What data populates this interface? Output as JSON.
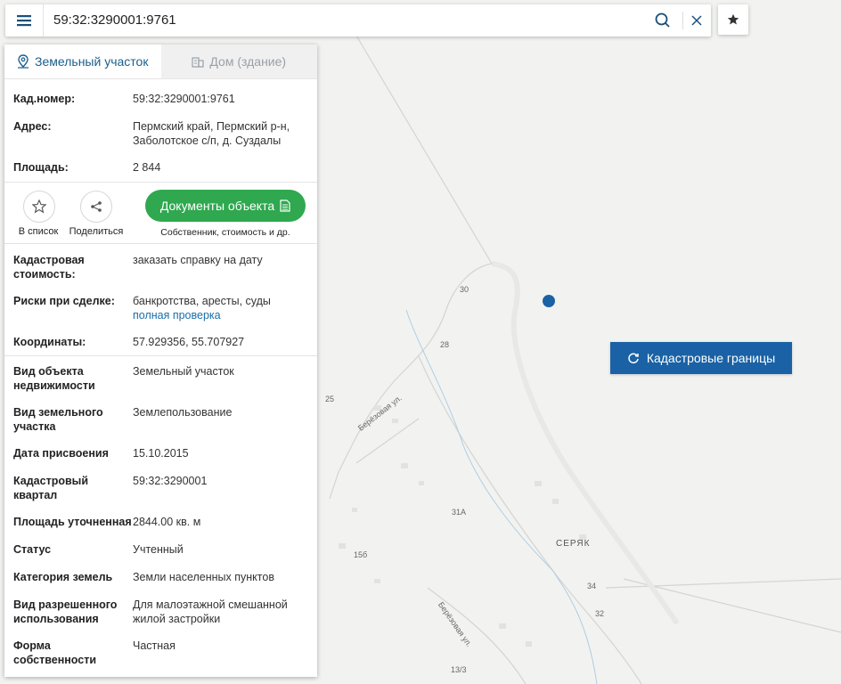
{
  "search": {
    "query": "59:32:3290001:9761"
  },
  "tabs": [
    {
      "label": "Земельный участок",
      "active": true
    },
    {
      "label": "Дом (здание)",
      "active": false
    }
  ],
  "summary": {
    "cad_number_label": "Кад.номер:",
    "cad_number_value": "59:32:3290001:9761",
    "address_label": "Адрес:",
    "address_line1": "Пермский край, Пермский р-н,",
    "address_line2": "Заболотское с/п, д. Суздалы",
    "area_label": "Площадь:",
    "area_value": "2 844"
  },
  "actions": {
    "add_to_list": "В список",
    "share": "Поделиться",
    "documents_button": "Документы объекта",
    "documents_sub": "Собственник, стоимость и др."
  },
  "details": {
    "cad_cost_label1": "Кадастровая",
    "cad_cost_label2": "стоимость:",
    "cad_cost_link": "заказать справку на дату",
    "risks_label": "Риски при сделке:",
    "risks_value": "банкротства, аресты, суды",
    "risks_link": "полная проверка",
    "coords_label": "Координаты:",
    "coords_value": "57.929356, 55.707927"
  },
  "props": [
    {
      "label1": "Вид объекта",
      "label2": "недвижимости",
      "value1": "Земельный участок",
      "value2": ""
    },
    {
      "label1": "Вид земельного",
      "label2": "участка",
      "value1": "Землепользование",
      "value2": ""
    },
    {
      "label1": "Дата присвоения",
      "label2": "",
      "value1": "15.10.2015",
      "value2": ""
    },
    {
      "label1": "Кадастровый",
      "label2": "квартал",
      "value1": "59:32:3290001",
      "value2": ""
    },
    {
      "label1": "Площадь уточненная",
      "label2": "",
      "value1": "2844.00 кв. м",
      "value2": ""
    },
    {
      "label1": "Статус",
      "label2": "",
      "value1": "Учтенный",
      "value2": ""
    },
    {
      "label1": "Категория земель",
      "label2": "",
      "value1": "Земли населенных пунктов",
      "value2": ""
    },
    {
      "label1": "Вид разрешенного",
      "label2": "использования",
      "value1": "Для малоэтажной смешанной",
      "value2": "жилой застройки"
    },
    {
      "label1": "Форма",
      "label2": "собственности",
      "value1": "Частная",
      "value2": ""
    }
  ],
  "map": {
    "cad_borders_button": "Кадастровые границы",
    "labels": {
      "n30": "30",
      "n28": "28",
      "n25": "25",
      "n31a": "31А",
      "n15b": "15б",
      "n34": "34",
      "n32": "32",
      "n13_3": "13/3",
      "street1": "Берёзовая ул.",
      "street2": "Берёзовая ул.",
      "village": "СЕРЯК"
    },
    "colors": {
      "marker": "#1a62a5",
      "button": "#1a62a5",
      "green": "#2fa84f"
    }
  }
}
